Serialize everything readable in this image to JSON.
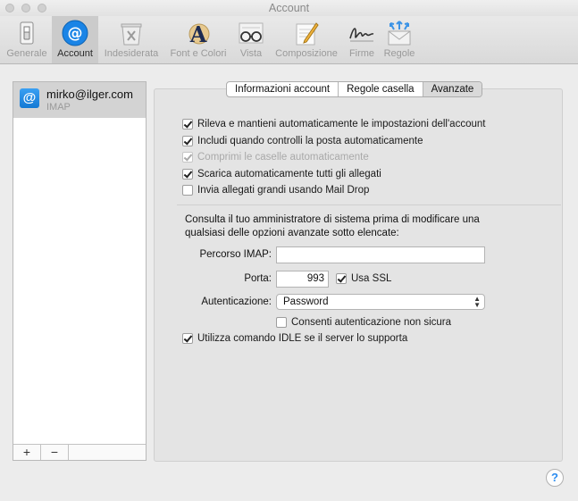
{
  "window": {
    "title": "Account"
  },
  "toolbar": {
    "items": [
      {
        "label": "Generale",
        "icon": "light-switch-icon"
      },
      {
        "label": "Account",
        "icon": "at-sign-icon",
        "active": true
      },
      {
        "label": "Indesiderata",
        "icon": "junk-bin-icon"
      },
      {
        "label": "Font e Colori",
        "icon": "font-icon"
      },
      {
        "label": "Vista",
        "icon": "glasses-icon"
      },
      {
        "label": "Composizione",
        "icon": "pencil-icon"
      },
      {
        "label": "Firme",
        "icon": "signature-icon"
      },
      {
        "label": "Regole",
        "icon": "rules-envelope-icon"
      }
    ]
  },
  "sidebar": {
    "accounts": [
      {
        "name": "mirko@ilger.com",
        "type": "IMAP",
        "icon": "at-sign-icon"
      }
    ],
    "add_label": "+",
    "remove_label": "−"
  },
  "tabs": [
    {
      "label": "Informazioni account"
    },
    {
      "label": "Regole casella"
    },
    {
      "label": "Avanzate",
      "selected": true
    }
  ],
  "options": {
    "auto_detect": {
      "label": "Rileva e mantieni automaticamente le impostazioni dell'account",
      "checked": true
    },
    "include_check": {
      "label": "Includi quando controlli la posta automaticamente",
      "checked": true
    },
    "compact": {
      "label": "Comprimi le caselle automaticamente",
      "checked": true,
      "disabled": true
    },
    "download_attachments": {
      "label": "Scarica automaticamente tutti gli allegati",
      "checked": true
    },
    "mail_drop": {
      "label": "Invia allegati grandi usando Mail Drop",
      "checked": false
    }
  },
  "advanced": {
    "notice": "Consulta il tuo amministratore di sistema prima di modificare una qualsiasi delle opzioni avanzate sotto elencate:",
    "imap_path": {
      "label": "Percorso IMAP:",
      "value": ""
    },
    "port": {
      "label": "Porta:",
      "value": "993"
    },
    "ssl": {
      "label": "Usa SSL",
      "checked": true
    },
    "auth": {
      "label": "Autenticazione:",
      "value": "Password"
    },
    "insecure_auth": {
      "label": "Consenti autenticazione non sicura",
      "checked": false
    },
    "idle": {
      "label": "Utilizza comando IDLE se il server lo supporta",
      "checked": true
    }
  },
  "help": {
    "label": "?"
  },
  "colors": {
    "accent": "#1a84e6",
    "panel": "#e4e4e4",
    "window": "#ececec"
  }
}
